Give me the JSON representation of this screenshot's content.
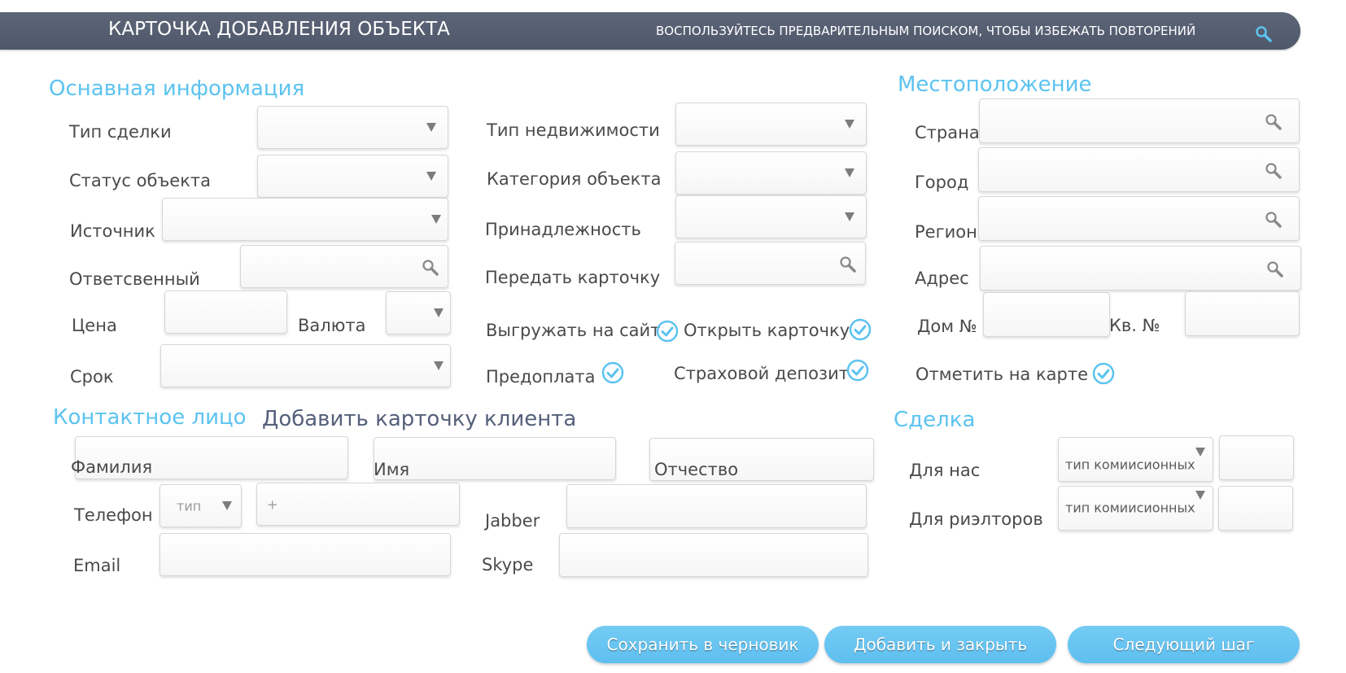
{
  "header": {
    "title": "КАРТОЧКА ДОБАВЛЕНИЯ ОБЪЕКТА",
    "hint": "ВОСПОЛЬЗУЙТЕСЬ ПРЕДВАРИТЕЛЬНЫМ ПОИСКОМ, ЧТОБЫ ИЗБЕЖАТЬ ПОВТОРЕНИЙ",
    "search_icon": "search-icon"
  },
  "main_info": {
    "title": "Оснавная информация",
    "deal_type": "Тип сделки",
    "object_status": "Статус объекта",
    "source": "Источник",
    "responsible": "Ответсвенный",
    "price": "Цена",
    "currency": "Валюта",
    "term": "Срок",
    "property_type": "Тип недвижимости",
    "object_category": "Категория объекта",
    "ownership": "Принадлежность",
    "transfer_card": "Передать карточку",
    "upload_to_site": "Выгружать на сайт",
    "open_card": "Открыть карточку",
    "prepayment": "Предоплата",
    "insurance_deposit": "Страховой депозит"
  },
  "location": {
    "title": "Местоположение",
    "country": "Страна",
    "city": "Город",
    "region": "Регион",
    "address": "Адрес",
    "house_no": "Дом №",
    "apt_no": "Кв. №",
    "mark_on_map": "Отметить на карте"
  },
  "contact": {
    "title": "Контактное лицо",
    "add_client_card": "Добавить карточку клиента",
    "last_name": "Фамилия",
    "first_name": "Имя",
    "patronymic": "Отчество",
    "phone": "Телефон",
    "phone_type_placeholder": "тип",
    "phone_number_placeholder": "+",
    "jabber": "Jabber",
    "email": "Email",
    "skype": "Skype"
  },
  "deal": {
    "title": "Сделка",
    "for_us": "Для нас",
    "for_realtors": "Для риэлторов",
    "commission_type": "тип комиисионных"
  },
  "buttons": {
    "save_draft": "Сохранить в черновик",
    "add_and_close": "Добавить и закрыть",
    "next_step": "Следующий шаг"
  },
  "colors": {
    "header_bg": "#545c70",
    "accent": "#5cc3f0",
    "button": "#6ac6f2"
  }
}
